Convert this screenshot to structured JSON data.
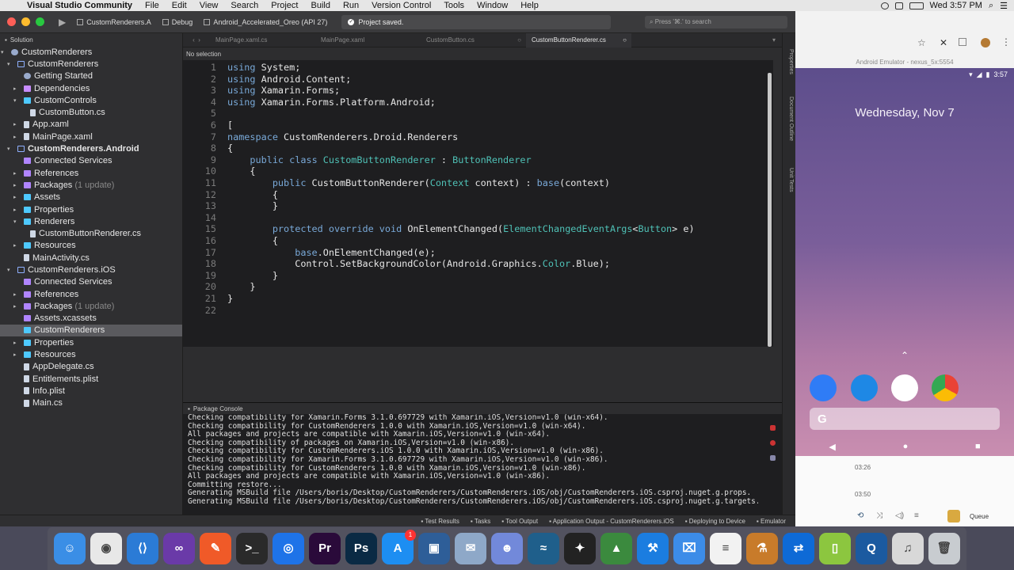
{
  "menubar": {
    "app_name": "Visual Studio Community",
    "items": [
      "File",
      "Edit",
      "View",
      "Search",
      "Project",
      "Build",
      "Run",
      "Version Control",
      "Tools",
      "Window",
      "Help"
    ],
    "clock": "Wed 3:57 PM"
  },
  "toolbar": {
    "solution_selector": "CustomRenderers.A",
    "config_selector": "Debug",
    "device_selector": "Android_Accelerated_Oreo (API 27)",
    "status_message": "Project saved.",
    "search_placeholder": "Press '⌘.' to search"
  },
  "solution": {
    "header": "Solution",
    "rows": [
      {
        "label": "CustomRenderers",
        "icon": "gear",
        "arrow": "▾",
        "level": 0,
        "bold": false
      },
      {
        "label": "CustomRenderers",
        "icon": "proj",
        "arrow": "▾",
        "level": 1,
        "bold": false
      },
      {
        "label": "Getting Started",
        "icon": "gear",
        "arrow": "",
        "level": 2,
        "bold": false
      },
      {
        "label": "Dependencies",
        "icon": "dep",
        "arrow": "▸",
        "level": 2,
        "bold": false
      },
      {
        "label": "CustomControls",
        "icon": "folder",
        "arrow": "▾",
        "level": 2,
        "bold": false
      },
      {
        "label": "CustomButton.cs",
        "icon": "file",
        "arrow": "",
        "level": 3,
        "bold": false
      },
      {
        "label": "App.xaml",
        "icon": "file",
        "arrow": "▸",
        "level": 2,
        "bold": false
      },
      {
        "label": "MainPage.xaml",
        "icon": "file",
        "arrow": "▸",
        "level": 2,
        "bold": false
      },
      {
        "label": "CustomRenderers.Android",
        "icon": "proj",
        "arrow": "▾",
        "level": 1,
        "bold": true
      },
      {
        "label": "Connected Services",
        "icon": "pkg",
        "arrow": "",
        "level": 2,
        "bold": false
      },
      {
        "label": "References",
        "icon": "pkg",
        "arrow": "▸",
        "level": 2,
        "bold": false
      },
      {
        "label": "Packages",
        "icon": "pkg",
        "arrow": "▸",
        "level": 2,
        "bold": false,
        "sub": "(1 update)"
      },
      {
        "label": "Assets",
        "icon": "folder",
        "arrow": "▸",
        "level": 2,
        "bold": false
      },
      {
        "label": "Properties",
        "icon": "folder",
        "arrow": "▸",
        "level": 2,
        "bold": false
      },
      {
        "label": "Renderers",
        "icon": "folder",
        "arrow": "▾",
        "level": 2,
        "bold": false
      },
      {
        "label": "CustomButtonRenderer.cs",
        "icon": "file",
        "arrow": "",
        "level": 3,
        "bold": false
      },
      {
        "label": "Resources",
        "icon": "folder",
        "arrow": "▸",
        "level": 2,
        "bold": false
      },
      {
        "label": "MainActivity.cs",
        "icon": "file",
        "arrow": "",
        "level": 2,
        "bold": false
      },
      {
        "label": "CustomRenderers.iOS",
        "icon": "proj",
        "arrow": "▾",
        "level": 1,
        "bold": false
      },
      {
        "label": "Connected Services",
        "icon": "pkg",
        "arrow": "",
        "level": 2,
        "bold": false
      },
      {
        "label": "References",
        "icon": "pkg",
        "arrow": "▸",
        "level": 2,
        "bold": false
      },
      {
        "label": "Packages",
        "icon": "pkg",
        "arrow": "▸",
        "level": 2,
        "bold": false,
        "sub": "(1 update)"
      },
      {
        "label": "Assets.xcassets",
        "icon": "pkg",
        "arrow": "",
        "level": 2,
        "bold": false
      },
      {
        "label": "CustomRenderers",
        "icon": "folder",
        "arrow": "",
        "level": 2,
        "bold": false,
        "selected": true
      },
      {
        "label": "Properties",
        "icon": "folder",
        "arrow": "▸",
        "level": 2,
        "bold": false
      },
      {
        "label": "Resources",
        "icon": "folder",
        "arrow": "▸",
        "level": 2,
        "bold": false
      },
      {
        "label": "AppDelegate.cs",
        "icon": "file",
        "arrow": "",
        "level": 2,
        "bold": false
      },
      {
        "label": "Entitlements.plist",
        "icon": "file",
        "arrow": "",
        "level": 2,
        "bold": false
      },
      {
        "label": "Info.plist",
        "icon": "file",
        "arrow": "",
        "level": 2,
        "bold": false
      },
      {
        "label": "Main.cs",
        "icon": "file",
        "arrow": "",
        "level": 2,
        "bold": false
      }
    ]
  },
  "tabs": [
    "MainPage.xaml.cs",
    "MainPage.xaml",
    "CustomButton.cs",
    "CustomButtonRenderer.cs"
  ],
  "active_tab_index": 3,
  "selection_status": "No selection",
  "code_lines": [
    [
      [
        "kw",
        "using"
      ],
      [
        "t",
        " System;"
      ]
    ],
    [
      [
        "kw",
        "using"
      ],
      [
        "t",
        " Android.Content;"
      ]
    ],
    [
      [
        "kw",
        "using"
      ],
      [
        "t",
        " Xamarin.Forms;"
      ]
    ],
    [
      [
        "kw",
        "using"
      ],
      [
        "t",
        " Xamarin.Forms.Platform.Android;"
      ]
    ],
    [],
    [
      [
        "t",
        "["
      ]
    ],
    [
      [
        "kw",
        "namespace"
      ],
      [
        "t",
        " CustomRenderers.Droid.Renderers"
      ]
    ],
    [
      [
        "t",
        "{"
      ]
    ],
    [
      [
        "t",
        "    "
      ],
      [
        "kw",
        "public"
      ],
      [
        "t",
        " "
      ],
      [
        "kw",
        "class"
      ],
      [
        "t",
        " "
      ],
      [
        "ty",
        "CustomButtonRenderer"
      ],
      [
        "t",
        " : "
      ],
      [
        "ty",
        "ButtonRenderer"
      ]
    ],
    [
      [
        "t",
        "    {"
      ]
    ],
    [
      [
        "t",
        "        "
      ],
      [
        "kw",
        "public"
      ],
      [
        "t",
        " CustomButtonRenderer("
      ],
      [
        "ty",
        "Context"
      ],
      [
        "t",
        " context) : "
      ],
      [
        "kw",
        "base"
      ],
      [
        "t",
        "(context)"
      ]
    ],
    [
      [
        "t",
        "        {"
      ]
    ],
    [
      [
        "t",
        "        }"
      ]
    ],
    [],
    [
      [
        "t",
        "        "
      ],
      [
        "kw",
        "protected"
      ],
      [
        "t",
        " "
      ],
      [
        "kw",
        "override"
      ],
      [
        "t",
        " "
      ],
      [
        "kw",
        "void"
      ],
      [
        "t",
        " OnElementChanged("
      ],
      [
        "ty",
        "ElementChangedEventArgs"
      ],
      [
        "t",
        "<"
      ],
      [
        "ty",
        "Button"
      ],
      [
        "t",
        "> e)"
      ]
    ],
    [
      [
        "t",
        "        {"
      ]
    ],
    [
      [
        "t",
        "            "
      ],
      [
        "kw",
        "base"
      ],
      [
        "t",
        ".OnElementChanged(e);"
      ]
    ],
    [
      [
        "t",
        "            Control.SetBackgroundColor(Android.Graphics."
      ],
      [
        "ty",
        "Color"
      ],
      [
        "t",
        ".Blue);"
      ]
    ],
    [
      [
        "t",
        "        }"
      ]
    ],
    [
      [
        "t",
        "    }"
      ]
    ],
    [
      [
        "t",
        "}"
      ]
    ],
    []
  ],
  "console": {
    "title": "Package Console",
    "lines": [
      "Checking compatibility for Xamarin.Forms 3.1.0.697729 with Xamarin.iOS,Version=v1.0 (win-x64).",
      "Checking compatibility for CustomRenderers 1.0.0 with Xamarin.iOS,Version=v1.0 (win-x64).",
      "All packages and projects are compatible with Xamarin.iOS,Version=v1.0 (win-x64).",
      "Checking compatibility of packages on Xamarin.iOS,Version=v1.0 (win-x86).",
      "Checking compatibility for CustomRenderers.iOS 1.0.0 with Xamarin.iOS,Version=v1.0 (win-x86).",
      "Checking compatibility for Xamarin.Forms 3.1.0.697729 with Xamarin.iOS,Version=v1.0 (win-x86).",
      "Checking compatibility for CustomRenderers 1.0.0 with Xamarin.iOS,Version=v1.0 (win-x86).",
      "All packages and projects are compatible with Xamarin.iOS,Version=v1.0 (win-x86).",
      "Committing restore...",
      "Generating MSBuild file /Users/boris/Desktop/CustomRenderers/CustomRenderers.iOS/obj/CustomRenderers.iOS.csproj.nuget.g.props.",
      "Generating MSBuild file /Users/boris/Desktop/CustomRenderers/CustomRenderers.iOS/obj/CustomRenderers.iOS.csproj.nuget.g.targets."
    ]
  },
  "statusbar": {
    "items": [
      "Test Results",
      "Tasks",
      "Tool Output",
      "Application Output - CustomRenderers.iOS",
      "Deploying to Device",
      "Emulator"
    ]
  },
  "emulator": {
    "title": "Android Emulator - nexus_5x:5554",
    "time": "3:57",
    "date": "Wednesday, Nov 7",
    "google_letter": "G",
    "queue_label": "Queue",
    "row_times": [
      "03:26",
      "03:50"
    ]
  },
  "dock": {
    "apps": [
      {
        "name": "finder",
        "color": "#3a8ee6",
        "glyph": "☺"
      },
      {
        "name": "chrome",
        "color": "#e8e8e8",
        "glyph": "◉"
      },
      {
        "name": "vscode",
        "color": "#2b7bd6",
        "glyph": "⟨⟩"
      },
      {
        "name": "visual-studio",
        "color": "#6a3aa8",
        "glyph": "∞"
      },
      {
        "name": "paw",
        "color": "#f05a28",
        "glyph": "✎"
      },
      {
        "name": "terminal",
        "color": "#2a2a2a",
        "glyph": ">_"
      },
      {
        "name": "maps",
        "color": "#1e73e8",
        "glyph": "◎"
      },
      {
        "name": "premiere",
        "color": "#2a0a3a",
        "glyph": "Pr"
      },
      {
        "name": "photoshop",
        "color": "#0a2a44",
        "glyph": "Ps"
      },
      {
        "name": "app-store",
        "color": "#1d8ef2",
        "glyph": "A",
        "badge": "1"
      },
      {
        "name": "virtualbox",
        "color": "#2e5e98",
        "glyph": "▣"
      },
      {
        "name": "preview",
        "color": "#8ea8c8",
        "glyph": "✉"
      },
      {
        "name": "discord",
        "color": "#7289da",
        "glyph": "☻"
      },
      {
        "name": "mysql",
        "color": "#1f5f8b",
        "glyph": "≈"
      },
      {
        "name": "figma",
        "color": "#222",
        "glyph": "✦"
      },
      {
        "name": "android-studio",
        "color": "#3b8a3e",
        "glyph": "▲"
      },
      {
        "name": "xcode",
        "color": "#1b7de0",
        "glyph": "⚒"
      },
      {
        "name": "simulator",
        "color": "#3c8ce8",
        "glyph": "⌧"
      },
      {
        "name": "textedit",
        "color": "#f2f2f2",
        "glyph": "≡"
      },
      {
        "name": "cocktail",
        "color": "#c87b2a",
        "glyph": "⚗"
      },
      {
        "name": "teamviewer",
        "color": "#0e6ad6",
        "glyph": "⇄"
      },
      {
        "name": "genymotion",
        "color": "#8cc63f",
        "glyph": "▯"
      },
      {
        "name": "quicktime",
        "color": "#1b5aa0",
        "glyph": "Q"
      },
      {
        "name": "music",
        "color": "#d8d8d8",
        "glyph": "♫"
      },
      {
        "name": "trash",
        "color": "#c8ccd0",
        "glyph": "🗑"
      }
    ]
  }
}
